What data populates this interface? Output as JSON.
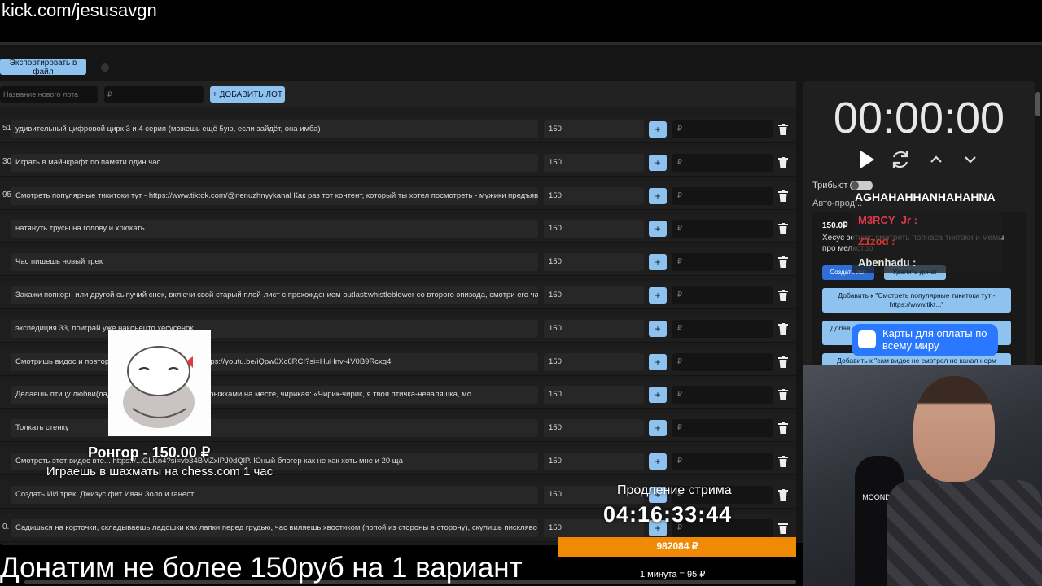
{
  "browser": {
    "url": "kick.com/jesusavgn"
  },
  "toolbar": {
    "export_label": "Экспортировать в файл"
  },
  "new_lot": {
    "name_placeholder": "Название нового лота",
    "amount_placeholder": "₽",
    "add_label": "+ ДОБАВИТЬ ЛОТ"
  },
  "lots": [
    {
      "num": "51.",
      "title": "удивительный цифровой цирк 3 и 4 серия (можешь ещё 5ую, если зайдёт, она имба)",
      "amount": "150",
      "plus": "+",
      "rub": "₽"
    },
    {
      "num": "30.",
      "title": "Играть в майнкрафт по памяти один час",
      "amount": "150",
      "plus": "+",
      "rub": "₽"
    },
    {
      "num": "95.",
      "title": "Смотреть популярные тикитоки тут - https://www.tiktok.com/@nenuzhnyykanal Как раз тот контент, который ты хотел посмотреть - мужики предъявляют же",
      "amount": "150",
      "plus": "+",
      "rub": "₽"
    },
    {
      "num": "",
      "title": "натянуть трусы на голову и хрюкать",
      "amount": "150",
      "plus": "+",
      "rub": "₽"
    },
    {
      "num": "",
      "title": "Час пишешь новый трек",
      "amount": "150",
      "plus": "+",
      "rub": "₽"
    },
    {
      "num": "",
      "title": "Закажи попкорн или другой сыпучий снек, включи свой старый плей-лист с прохождением outlast:whistleblower со второго эпизода, смотри его час, эмоци",
      "amount": "150",
      "plus": "+",
      "rub": "₽"
    },
    {
      "num": "",
      "title": "экспедиция 33, поиграй уже наконецто хесусенок",
      "amount": "150",
      "plus": "+",
      "rub": "₽"
    },
    {
      "num": "",
      "title": "Смотришь видос и повторяешь ... ся делать намаз. https://youtu.be/iQpw0Xc6RCI?si=HuHnv-4V0B9Rcxg4",
      "amount": "150",
      "plus": "+",
      "rub": "₽"
    },
    {
      "num": "",
      "title": "Делаешь птицу любви(ладо... таешь перед камерой прыжками на месте, чирикая: «Чирик-чирик, я твоя птичка-неваляшка, мо",
      "amount": "150",
      "plus": "+",
      "rub": "₽"
    },
    {
      "num": "",
      "title": "Толкать стенку",
      "amount": "150",
      "plus": "+",
      "rub": "₽"
    },
    {
      "num": "",
      "title": "Смотреть этот видос вте... https://...GLKn4?si=vb34BMZxlPJ0dQlP. Юный блогер как не как хоть мне и 20 ща",
      "amount": "150",
      "plus": "+",
      "rub": "₽"
    },
    {
      "num": "",
      "title": "Создать ИИ трек, Джизус фит Иван Золо и ганест",
      "amount": "150",
      "plus": "+",
      "rub": "₽"
    },
    {
      "num": "0.",
      "title": "Садишься на корточки, складываешь ладошки как лапки перед грудью, час виляешь хвостиком (попой из стороны в сторону), скулишь писклявo и лаеш",
      "amount": "150",
      "plus": "+",
      "rub": "₽"
    }
  ],
  "timer": {
    "value": "00:00:00"
  },
  "controls": {
    "play_icon": "play-icon",
    "refresh_icon": "refresh-icon",
    "up_icon": "chevron-up-icon",
    "down_icon": "chevron-down-icon"
  },
  "settings": {
    "tribute_label": "Трибьют",
    "auto_label": "Авто-прод..."
  },
  "donation": {
    "price": "150.0₽",
    "text": "Хесус зетник: смотреть полчаса тиктоки и мемы про мелкстро",
    "create_label": "Создать лот",
    "delete_label": "Удалить донат",
    "options": [
      "Добавить к \"Смотреть популярные тикитоки тут - https://www.tikt...\"",
      "Добав...",
      "Добавить к \"сам видос не смотрел но канал норм"
    ]
  },
  "chat": {
    "big": "AGHAHAHHANHAHAHNA",
    "rows": [
      {
        "text": "M3RCY_Jr :",
        "color": "#e0384a"
      },
      {
        "text": "Z1zod :",
        "color": "#d8342f"
      },
      {
        "text": "Abenhadu :",
        "color": "#e8e8e8"
      }
    ]
  },
  "ad": {
    "text": "Карты для оплаты по всему миру"
  },
  "webcam": {
    "mic_label": "MOONDO"
  },
  "donation_alert": {
    "name": "Ронгор - 150.00 ₽",
    "text": "Играешь в шахматы на chess.com 1 час"
  },
  "stream_ext": {
    "label": "Продление стрима",
    "timer": "04:16:33:44"
  },
  "progress": {
    "label": "982084 ₽",
    "rate": "1 минута = 95 ₽",
    "color": "#f08a05"
  },
  "footer": {
    "text": "Донатим не более 150руб на 1 вариант"
  }
}
